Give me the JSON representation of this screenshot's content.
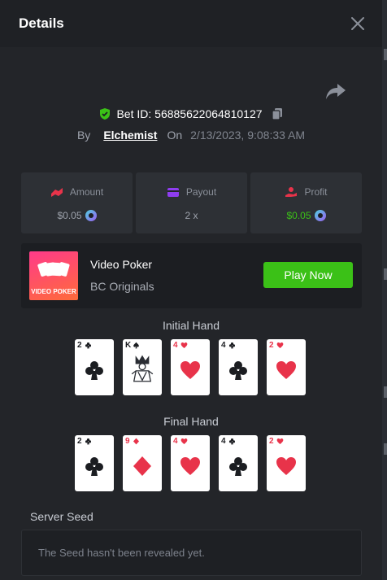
{
  "header": {
    "title": "Details"
  },
  "bet": {
    "id_label": "Bet ID: 56885622064810127",
    "by_label": "By",
    "user": "Elchemist",
    "on_label": "On",
    "date": "2/13/2023, 9:08:33 AM"
  },
  "stats": {
    "amount": {
      "label": "Amount",
      "value": "$0.05"
    },
    "payout": {
      "label": "Payout",
      "value": "2 x"
    },
    "profit": {
      "label": "Profit",
      "value": "$0.05"
    }
  },
  "game": {
    "name": "Video Poker",
    "provider": "BC Originals",
    "thumb_text": "VIDEO POKER",
    "play_label": "Play Now"
  },
  "initial_hand": {
    "label": "Initial Hand",
    "cards": [
      {
        "rank": "2",
        "suit": "club"
      },
      {
        "rank": "K",
        "suit": "spade"
      },
      {
        "rank": "4",
        "suit": "heart"
      },
      {
        "rank": "4",
        "suit": "club"
      },
      {
        "rank": "2",
        "suit": "heart"
      }
    ]
  },
  "final_hand": {
    "label": "Final Hand",
    "cards": [
      {
        "rank": "2",
        "suit": "club"
      },
      {
        "rank": "9",
        "suit": "diamond"
      },
      {
        "rank": "4",
        "suit": "heart"
      },
      {
        "rank": "4",
        "suit": "club"
      },
      {
        "rank": "2",
        "suit": "heart"
      }
    ]
  },
  "server_seed": {
    "label": "Server Seed",
    "text": "The Seed hasn't been revealed yet."
  },
  "colors": {
    "accent_green": "#3bc117",
    "amount_icon": "#e8334a",
    "payout_icon": "#8f3df0",
    "profit_icon": "#e8334a"
  }
}
